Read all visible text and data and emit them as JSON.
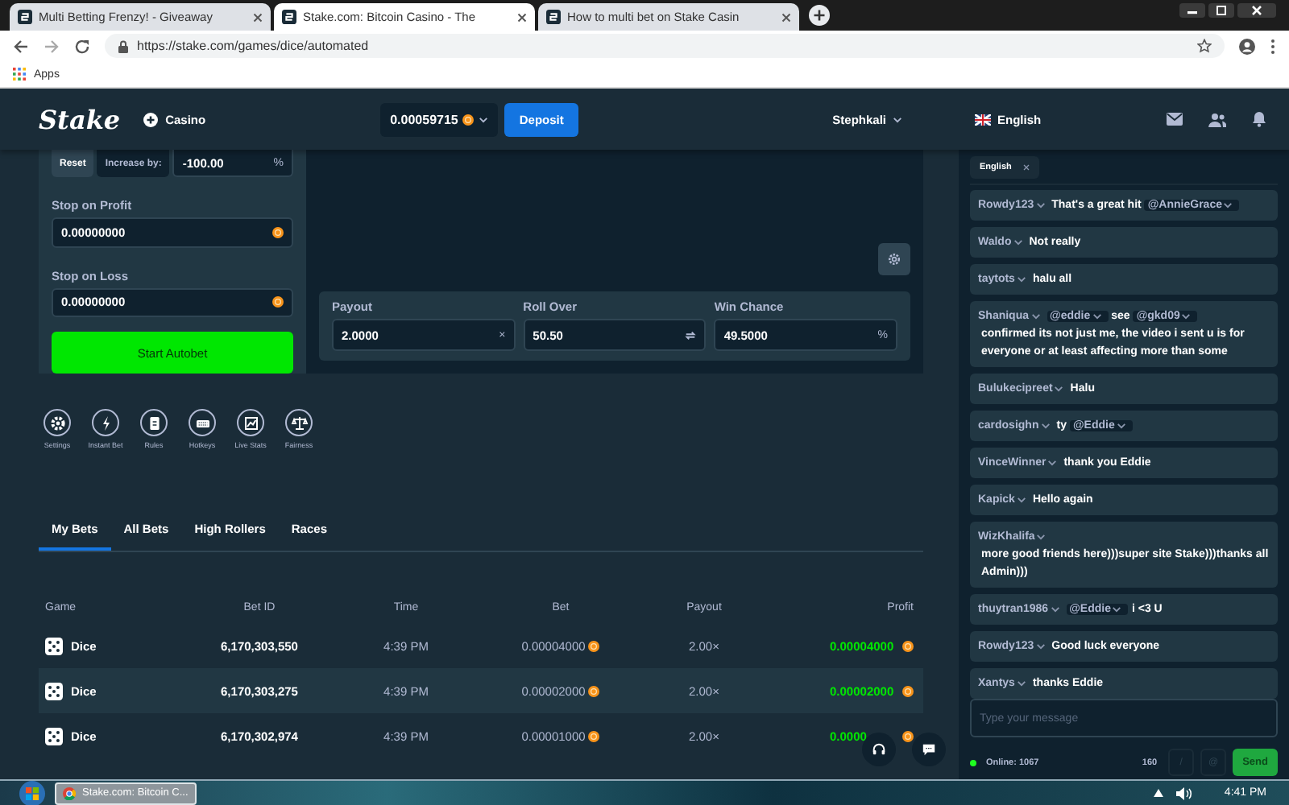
{
  "browser": {
    "tabs": [
      {
        "title": "Multi Betting Frenzy! - Giveaway",
        "selected": false
      },
      {
        "title": "Stake.com: Bitcoin Casino - The",
        "selected": true
      },
      {
        "title": "How to multi bet on Stake Casin",
        "selected": false
      }
    ],
    "address": "https://stake.com/games/dice/automated",
    "bookmarks": [
      "Apps"
    ]
  },
  "header": {
    "logo": "Stake",
    "section": "Casino",
    "balance": "0.00059715",
    "deposit": "Deposit",
    "user": "Stephkali",
    "language": "English"
  },
  "autobet": {
    "on_loss_options": [
      {
        "label": "Reset",
        "selected": true
      },
      {
        "label": "Increase by:",
        "selected": false
      }
    ],
    "increase_value": "-100.00",
    "increase_unit": "%",
    "stops": [
      {
        "label": "Stop on Profit",
        "value": "0.00000000"
      },
      {
        "label": "Stop on Loss",
        "value": "0.00000000"
      }
    ],
    "start_button": "Start Autobet"
  },
  "dice": {
    "fields": [
      {
        "label": "Payout",
        "value": "2.0000",
        "kind": "suffix",
        "suffix": "×"
      },
      {
        "label": "Roll Over",
        "value": "50.50",
        "kind": "swap"
      },
      {
        "label": "Win Chance",
        "value": "49.5000",
        "kind": "suffix",
        "suffix": "%"
      }
    ]
  },
  "tools": [
    {
      "label": "Settings",
      "kind": "settings"
    },
    {
      "label": "Instant Bet",
      "kind": "instant"
    },
    {
      "label": "Rules",
      "kind": "rules"
    },
    {
      "label": "Hotkeys",
      "kind": "hotkeys"
    },
    {
      "label": "Live Stats",
      "kind": "stats"
    },
    {
      "label": "Fairness",
      "kind": "fairness"
    }
  ],
  "bets": {
    "tabs": [
      {
        "label": "My Bets",
        "selected": true
      },
      {
        "label": "All Bets",
        "selected": false
      },
      {
        "label": "High Rollers",
        "selected": false
      },
      {
        "label": "Races",
        "selected": false
      }
    ],
    "columns": [
      "Game",
      "Bet ID",
      "Time",
      "Bet",
      "Payout",
      "Profit"
    ],
    "rows": [
      {
        "game": "Dice",
        "bet_id": "6,170,303,550",
        "time": "4:39 PM",
        "bet": "0.00004000",
        "payout": "2.00×",
        "profit": "0.00004000"
      },
      {
        "game": "Dice",
        "bet_id": "6,170,303,275",
        "time": "4:39 PM",
        "bet": "0.00002000",
        "payout": "2.00×",
        "profit": "0.00002000"
      },
      {
        "game": "Dice",
        "bet_id": "6,170,302,974",
        "time": "4:39 PM",
        "bet": "0.00001000",
        "payout": "2.00×",
        "profit": "0.0000"
      }
    ]
  },
  "chat": {
    "language_tag": "English",
    "messages": [
      {
        "user": "Rowdy123",
        "parts": [
          {
            "kind": "text",
            "text": "That's a great hit"
          },
          {
            "kind": "mention",
            "text": "@AnnieGrace"
          }
        ]
      },
      {
        "user": "Waldo",
        "parts": [
          {
            "kind": "text",
            "text": "Not really"
          }
        ]
      },
      {
        "user": "taytots",
        "parts": [
          {
            "kind": "text",
            "text": "halu all"
          }
        ]
      },
      {
        "user": "Shaniqua",
        "parts": [
          {
            "kind": "mention",
            "text": "@eddie"
          },
          {
            "kind": "text",
            "text": "see"
          },
          {
            "kind": "mention",
            "text": "@gkd09"
          },
          {
            "kind": "text",
            "text": "confirmed its not just me, the video i sent u is for everyone or at least affecting more than some"
          }
        ]
      },
      {
        "user": "Bulukecipreet",
        "parts": [
          {
            "kind": "text",
            "text": "Halu"
          }
        ]
      },
      {
        "user": "cardosighn",
        "parts": [
          {
            "kind": "text",
            "text": "ty"
          },
          {
            "kind": "mention",
            "text": "@Eddie"
          }
        ]
      },
      {
        "user": "VinceWinner",
        "parts": [
          {
            "kind": "text",
            "text": "thank you Eddie"
          }
        ]
      },
      {
        "user": "Kapick",
        "parts": [
          {
            "kind": "text",
            "text": "Hello again"
          }
        ]
      },
      {
        "user": "WizKhalifa",
        "parts": [
          {
            "kind": "text",
            "text": "more good friends here)))super site Stake)))thanks all Admin)))"
          }
        ]
      },
      {
        "user": "thuytran1986",
        "parts": [
          {
            "kind": "mention",
            "text": "@Eddie"
          },
          {
            "kind": "text",
            "text": "i <3 U"
          }
        ]
      },
      {
        "user": "Rowdy123",
        "parts": [
          {
            "kind": "text",
            "text": "Good luck everyone"
          }
        ]
      },
      {
        "user": "Xantys",
        "parts": [
          {
            "kind": "text",
            "text": "thanks Eddie"
          }
        ]
      }
    ],
    "placeholder": "Type your message",
    "online": "Online: 1067",
    "char_count": "160",
    "option_buttons": [
      "/",
      "@"
    ],
    "send": "Send"
  },
  "taskbar": {
    "apps": [
      {
        "title": "Stake.com: Bitcoin C..."
      }
    ],
    "clock": "4:41 PM"
  }
}
